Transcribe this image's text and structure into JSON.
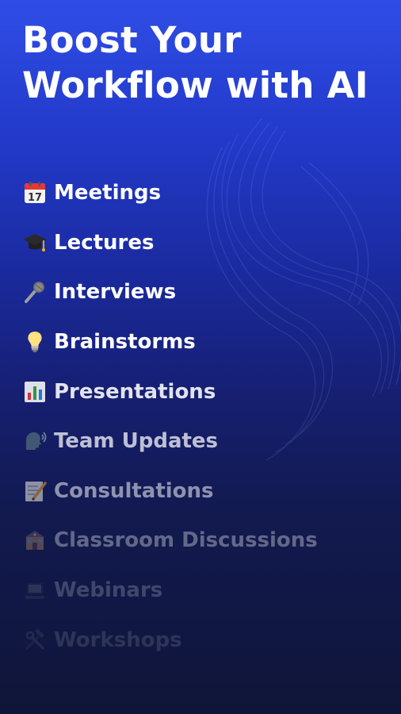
{
  "headline": "Boost Your Workflow with AI",
  "use_cases": [
    {
      "icon": "calendar-icon",
      "label": "Meetings",
      "opacity": 1
    },
    {
      "icon": "graduation-cap-icon",
      "label": "Lectures",
      "opacity": 1
    },
    {
      "icon": "microphone-icon",
      "label": "Interviews",
      "opacity": 1
    },
    {
      "icon": "lightbulb-icon",
      "label": "Brainstorms",
      "opacity": 1
    },
    {
      "icon": "bar-chart-icon",
      "label": "Presentations",
      "opacity": 0.88
    },
    {
      "icon": "speaking-head-icon",
      "label": "Team Updates",
      "opacity": 0.72
    },
    {
      "icon": "memo-icon",
      "label": "Consultations",
      "opacity": 0.52
    },
    {
      "icon": "school-icon",
      "label": "Classroom Discussions",
      "opacity": 0.34
    },
    {
      "icon": "laptop-icon",
      "label": "Webinars",
      "opacity": 0.2
    },
    {
      "icon": "tools-icon",
      "label": "Workshops",
      "opacity": 0.12
    }
  ],
  "colors": {
    "background_top": "#2f4de6",
    "background_bottom": "#0f1538",
    "text": "#ffffff"
  }
}
